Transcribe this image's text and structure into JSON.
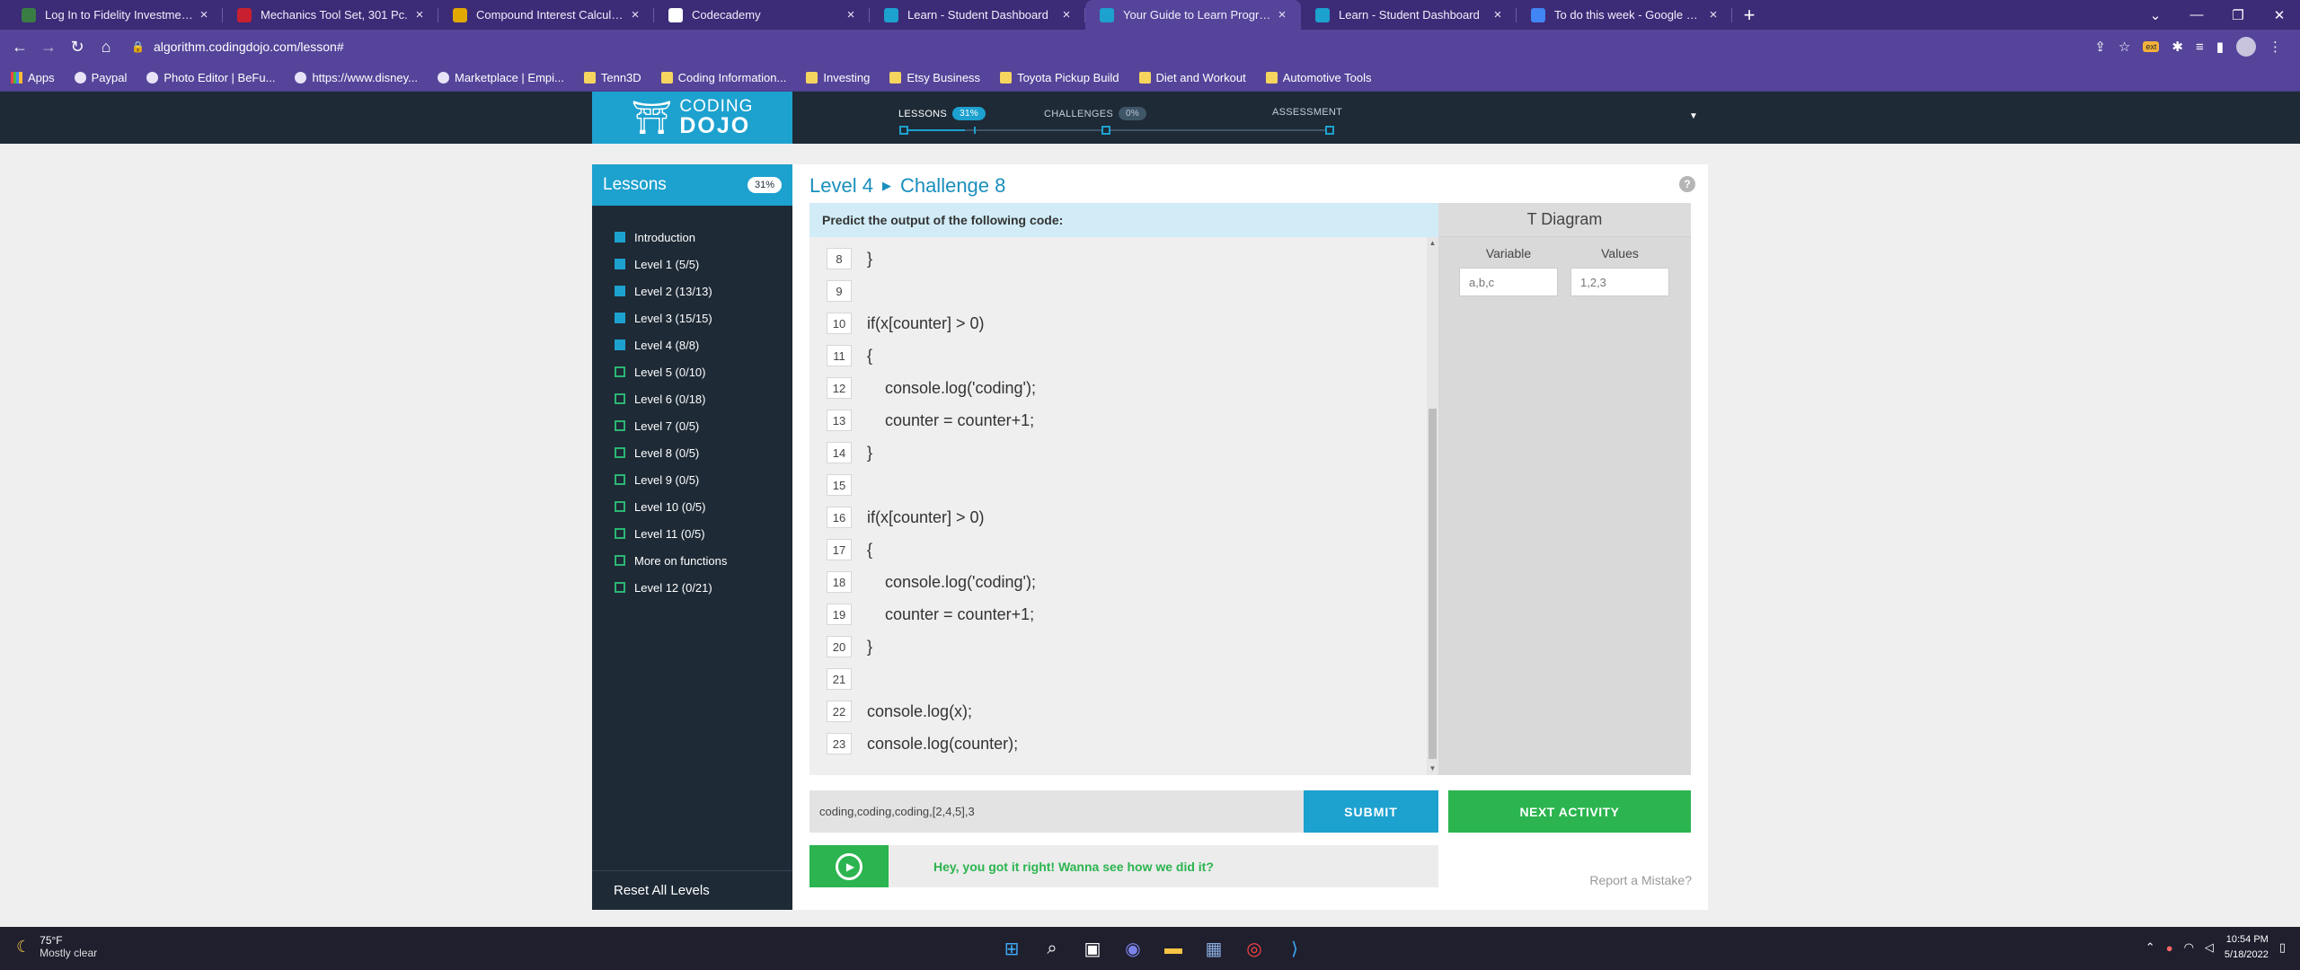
{
  "browser": {
    "tabs": [
      {
        "title": "Log In to Fidelity Investments",
        "fav_color": "#3a7d44",
        "active": false
      },
      {
        "title": "Mechanics Tool Set, 301 Pc.",
        "fav_color": "#c8202f",
        "active": false
      },
      {
        "title": "Compound Interest Calculator - I",
        "fav_color": "#e0a800",
        "active": false
      },
      {
        "title": "Codecademy",
        "fav_color": "#ffffff",
        "active": false
      },
      {
        "title": "Learn - Student Dashboard",
        "fav_color": "#1da1cf",
        "active": false
      },
      {
        "title": "Your Guide to Learn Programmin",
        "fav_color": "#1da1cf",
        "active": true
      },
      {
        "title": "Learn - Student Dashboard",
        "fav_color": "#1da1cf",
        "active": false
      },
      {
        "title": "To do this week - Google Docs",
        "fav_color": "#4285f4",
        "active": false
      }
    ],
    "url": "algorithm.codingdojo.com/lesson#",
    "bookmarks": [
      {
        "label": "Apps",
        "kind": "grid"
      },
      {
        "label": "Paypal",
        "kind": "site"
      },
      {
        "label": "Photo Editor | BeFu...",
        "kind": "site"
      },
      {
        "label": "https://www.disney...",
        "kind": "site"
      },
      {
        "label": "Marketplace | Empi...",
        "kind": "site"
      },
      {
        "label": "Tenn3D",
        "kind": "folder"
      },
      {
        "label": "Coding Information...",
        "kind": "folder"
      },
      {
        "label": "Investing",
        "kind": "folder"
      },
      {
        "label": "Etsy Business",
        "kind": "folder"
      },
      {
        "label": "Toyota Pickup Build",
        "kind": "folder"
      },
      {
        "label": "Diet and Workout",
        "kind": "folder"
      },
      {
        "label": "Automotive Tools",
        "kind": "folder"
      }
    ]
  },
  "header": {
    "logo_line1": "CODING",
    "logo_line2": "DOJO",
    "lessons_label": "LESSONS",
    "lessons_pct": "31%",
    "lessons_progress": 0.31,
    "challenges_label": "CHALLENGES",
    "challenges_pct": "0%",
    "assessment_label": "ASSESSMENT"
  },
  "sidebar": {
    "title": "Lessons",
    "pct": "31%",
    "items": [
      {
        "label": "Introduction",
        "done": true
      },
      {
        "label": "Level 1 (5/5)",
        "done": true
      },
      {
        "label": "Level 2 (13/13)",
        "done": true
      },
      {
        "label": "Level 3 (15/15)",
        "done": true
      },
      {
        "label": "Level 4 (8/8)",
        "done": true
      },
      {
        "label": "Level 5 (0/10)",
        "done": false
      },
      {
        "label": "Level 6 (0/18)",
        "done": false
      },
      {
        "label": "Level 7 (0/5)",
        "done": false
      },
      {
        "label": "Level 8 (0/5)",
        "done": false
      },
      {
        "label": "Level 9 (0/5)",
        "done": false
      },
      {
        "label": "Level 10 (0/5)",
        "done": false
      },
      {
        "label": "Level 11 (0/5)",
        "done": false
      },
      {
        "label": "More on functions",
        "done": false
      },
      {
        "label": "Level 12 (0/21)",
        "done": false
      }
    ],
    "reset_label": "Reset All Levels"
  },
  "lesson": {
    "level": "Level 4",
    "challenge": "Challenge 8",
    "prompt": "Predict the output of the following code:",
    "code": [
      {
        "n": "8",
        "text": "}"
      },
      {
        "n": "9",
        "text": ""
      },
      {
        "n": "10",
        "text": "if(x[counter] > 0)"
      },
      {
        "n": "11",
        "text": "{"
      },
      {
        "n": "12",
        "text": "    console.log('coding');"
      },
      {
        "n": "13",
        "text": "    counter = counter+1;"
      },
      {
        "n": "14",
        "text": "}"
      },
      {
        "n": "15",
        "text": ""
      },
      {
        "n": "16",
        "text": "if(x[counter] > 0)"
      },
      {
        "n": "17",
        "text": "{"
      },
      {
        "n": "18",
        "text": "    console.log('coding');"
      },
      {
        "n": "19",
        "text": "    counter = counter+1;"
      },
      {
        "n": "20",
        "text": "}"
      },
      {
        "n": "21",
        "text": ""
      },
      {
        "n": "22",
        "text": "console.log(x);"
      },
      {
        "n": "23",
        "text": "console.log(counter);"
      }
    ],
    "tdiagram": {
      "title": "T Diagram",
      "variable_header": "Variable",
      "values_header": "Values",
      "variable_value": "a,b,c",
      "values_value": "1,2,3"
    },
    "answer_value": "coding,coding,coding,[2,4,5],3",
    "submit_label": "SUBMIT",
    "next_label": "NEXT ACTIVITY",
    "feedback": "Hey, you got it right! Wanna see how we did it?",
    "report_label": "Report a Mistake?"
  },
  "taskbar": {
    "temp": "75°F",
    "condition": "Mostly clear",
    "time": "10:54 PM",
    "date": "5/18/2022"
  }
}
